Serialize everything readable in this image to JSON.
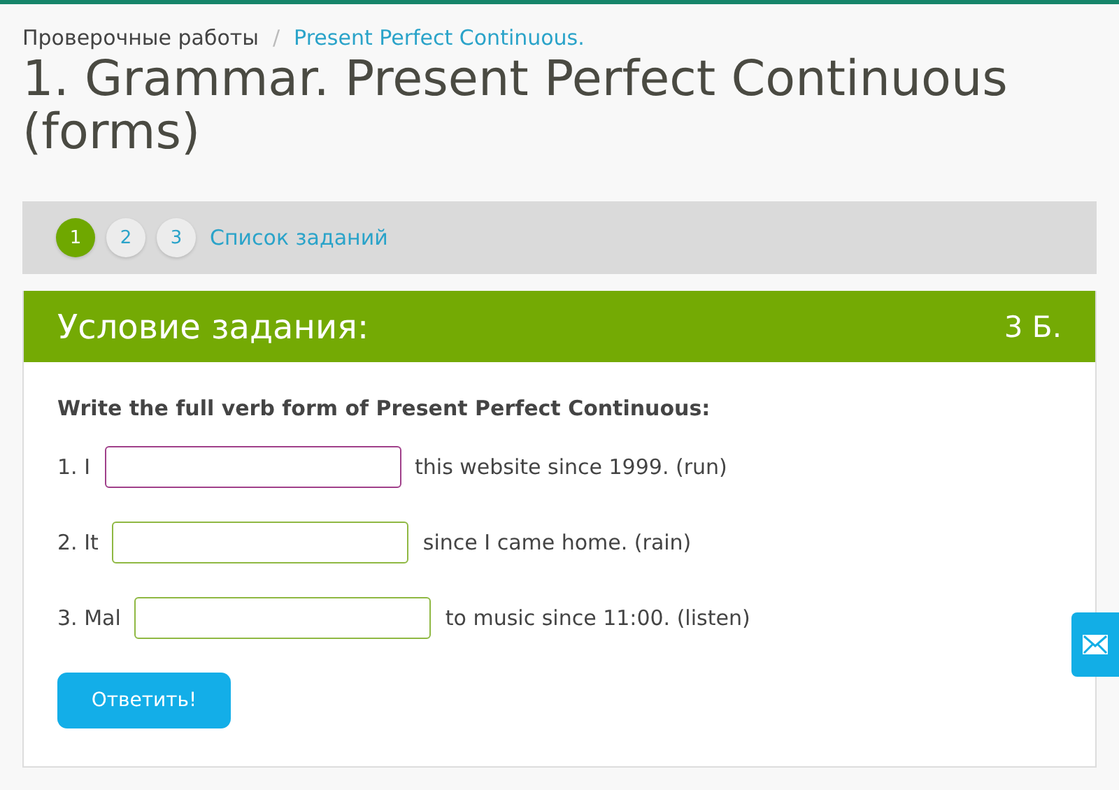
{
  "breadcrumb": [
    {
      "label": "Проверочные работы",
      "link": false
    },
    {
      "label": "Present Perfect Continuous.",
      "link": true
    }
  ],
  "breadcrumb_separator": "/",
  "title": "1. Grammar. Present Perfect Continuous (forms)",
  "steps": [
    {
      "label": "1",
      "selected": true
    },
    {
      "label": "2",
      "selected": false
    },
    {
      "label": "3",
      "selected": false
    }
  ],
  "task_list_link": "Список заданий",
  "task": {
    "header": "Условие задания:",
    "points": "3 Б.",
    "instruction": "Write the full verb form of Present Perfect Continuous:",
    "items": [
      {
        "prefix": "1. I",
        "suffix": "this website since 1999. (run)",
        "focused": true
      },
      {
        "prefix": "2. It",
        "suffix": "since I came home. (rain)",
        "focused": false
      },
      {
        "prefix": "3. Mal",
        "suffix": "to music since 11:00. (listen)",
        "focused": false
      }
    ],
    "submit": "Ответить!"
  }
}
